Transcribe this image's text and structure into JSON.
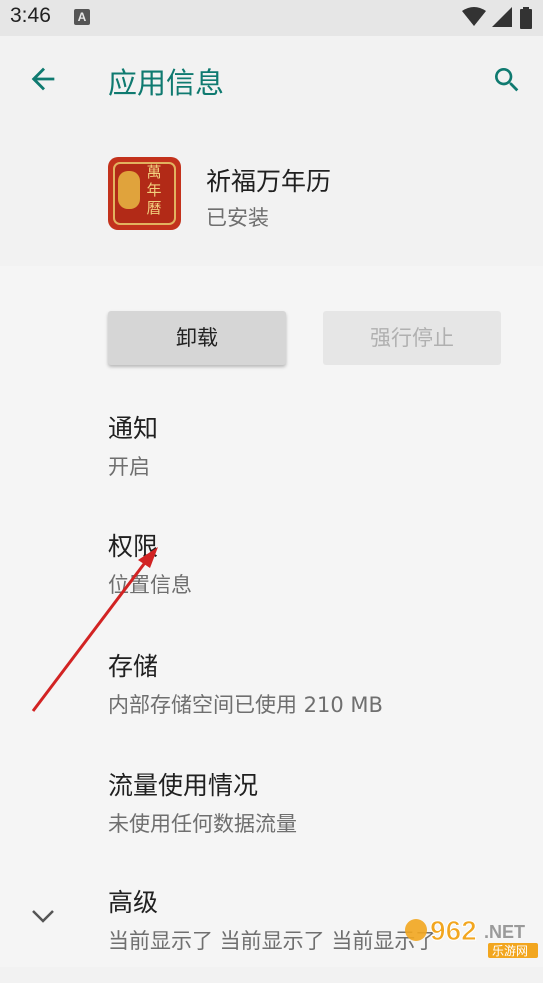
{
  "status_bar": {
    "time": "3:46",
    "notification_icon": "A",
    "icons": [
      "wifi-icon",
      "signal-icon",
      "battery-icon"
    ]
  },
  "app_bar": {
    "title": "应用信息",
    "back_icon": "arrow-left-icon",
    "search_icon": "search-icon",
    "accent_color": "#0f7a70"
  },
  "app": {
    "name": "祈福万年历",
    "status": "已安装",
    "icon_glyphs": [
      "萬",
      "年",
      "曆"
    ]
  },
  "actions": {
    "uninstall": "卸载",
    "force_stop": "强行停止"
  },
  "settings": [
    {
      "title": "通知",
      "summary": "开启"
    },
    {
      "title": "权限",
      "summary": "位置信息"
    },
    {
      "title": "存储",
      "summary": "内部存储空间已使用 210 MB"
    },
    {
      "title": "流量使用情况",
      "summary": "未使用任何数据流量"
    },
    {
      "title": "高级",
      "summary": "当前显示了 当前显示了 当前显示了"
    }
  ],
  "watermark": {
    "number": "962",
    "suffix": ".NET",
    "subtitle": "乐游网"
  }
}
